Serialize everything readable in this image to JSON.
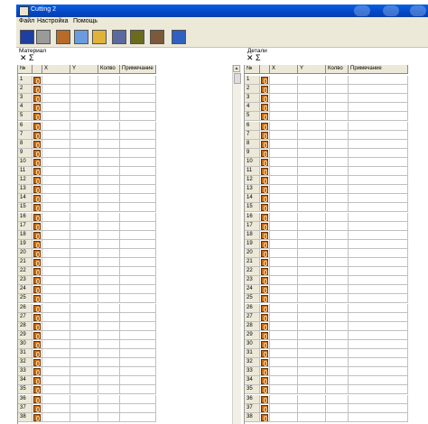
{
  "window": {
    "title": "Cutting 2"
  },
  "menu": [
    "Файл",
    "Настройка",
    "Помощь"
  ],
  "toolbar": [
    {
      "icon": "grid-blue-icon",
      "color": "#1c3fa0"
    },
    {
      "icon": "grid-grey-icon",
      "color": "#9a9a9a"
    },
    {
      "icon": "board-icon",
      "color": "#b86a28"
    },
    {
      "icon": "folder-open-icon",
      "color": "#6a9be0"
    },
    {
      "icon": "folder-color-icon",
      "color": "#e0b23a"
    },
    {
      "icon": "save-icon",
      "color": "#5a6aa0"
    },
    {
      "icon": "cut-save-icon",
      "color": "#6b6b20"
    },
    {
      "icon": "tools-icon",
      "color": "#7a5a3a"
    },
    {
      "icon": "export-icon",
      "color": "#3060c0"
    }
  ],
  "left": {
    "label": "Материал",
    "delete": "✕",
    "sum": "Σ",
    "columns": [
      "№",
      "",
      "X",
      "Y",
      "Колво",
      "Примечание"
    ],
    "rows": [
      "1",
      "2",
      "3",
      "4",
      "5",
      "6",
      "7",
      "8",
      "9",
      "10",
      "11",
      "12",
      "13",
      "14",
      "15",
      "16",
      "17",
      "18",
      "19",
      "20",
      "21",
      "22",
      "23",
      "24",
      "25",
      "26",
      "27",
      "28",
      "29",
      "30",
      "31",
      "32",
      "33",
      "34",
      "35",
      "36",
      "37",
      "38"
    ]
  },
  "right": {
    "label": "Детали",
    "delete": "✕",
    "sum": "Σ",
    "columns": [
      "№",
      "",
      "X",
      "Y",
      "Колво",
      "Примечание"
    ],
    "rows": [
      "1",
      "2",
      "3",
      "4",
      "5",
      "6",
      "7",
      "8",
      "9",
      "10",
      "11",
      "12",
      "13",
      "14",
      "15",
      "16",
      "17",
      "18",
      "19",
      "20",
      "21",
      "22",
      "23",
      "24",
      "25",
      "26",
      "27",
      "28",
      "29",
      "30",
      "31",
      "32",
      "33",
      "34",
      "35",
      "36",
      "37",
      "38"
    ]
  },
  "colors": {
    "swatch": "#c86a12"
  }
}
